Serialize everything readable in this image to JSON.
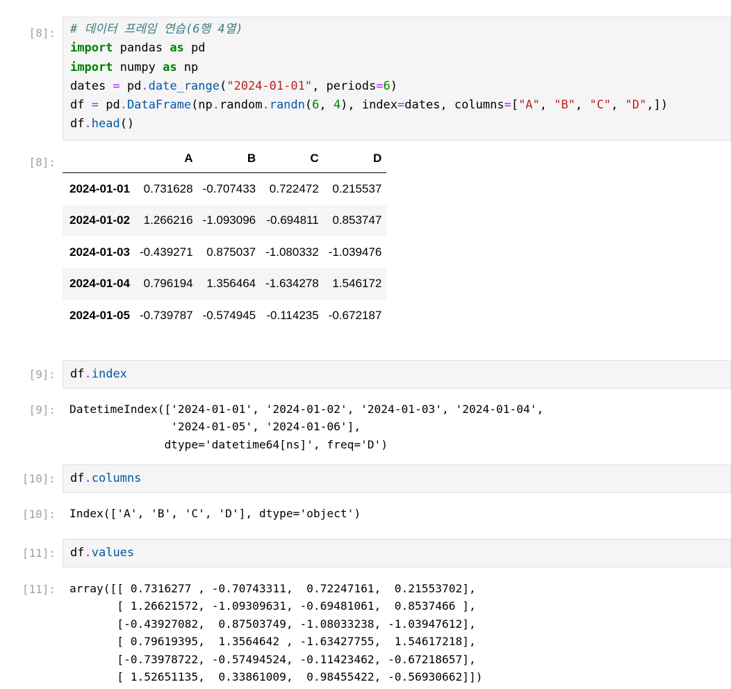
{
  "cells": [
    {
      "in_prompt": "[8]:",
      "out_prompt": "[8]:",
      "code_lines": [
        "# 데이터 프레임 연습(6행 4열)",
        "import pandas as pd",
        "import numpy as np",
        "dates = pd.date_range(\"2024-01-01\", periods=6)",
        "df = pd.DataFrame(np.random.randn(6, 4), index=dates, columns=[\"A\", \"B\", \"C\", \"D\",])",
        "df.head()"
      ],
      "table": {
        "columns": [
          "",
          "A",
          "B",
          "C",
          "D"
        ],
        "rows": [
          {
            "index": "2024-01-01",
            "values": [
              "0.731628",
              "-0.707433",
              "0.722472",
              "0.215537"
            ]
          },
          {
            "index": "2024-01-02",
            "values": [
              "1.266216",
              "-1.093096",
              "-0.694811",
              "0.853747"
            ]
          },
          {
            "index": "2024-01-03",
            "values": [
              "-0.439271",
              "0.875037",
              "-1.080332",
              "-1.039476"
            ]
          },
          {
            "index": "2024-01-04",
            "values": [
              "0.796194",
              "1.356464",
              "-1.634278",
              "1.546172"
            ]
          },
          {
            "index": "2024-01-05",
            "values": [
              "-0.739787",
              "-0.574945",
              "-0.114235",
              "-0.672187"
            ]
          }
        ]
      }
    },
    {
      "in_prompt": "[9]:",
      "out_prompt": "[9]:",
      "code": "df.index",
      "output_lines": [
        "DatetimeIndex(['2024-01-01', '2024-01-02', '2024-01-03', '2024-01-04',",
        "               '2024-01-05', '2024-01-06'],",
        "              dtype='datetime64[ns]', freq='D')"
      ]
    },
    {
      "in_prompt": "[10]:",
      "out_prompt": "[10]:",
      "code": "df.columns",
      "output_lines": [
        "Index(['A', 'B', 'C', 'D'], dtype='object')"
      ]
    },
    {
      "in_prompt": "[11]:",
      "out_prompt": "[11]:",
      "code": "df.values",
      "output_lines": [
        "array([[ 0.7316277 , -0.70743311,  0.72247161,  0.21553702],",
        "       [ 1.26621572, -1.09309631, -0.69481061,  0.8537466 ],",
        "       [-0.43927082,  0.87503749, -1.08033238, -1.03947612],",
        "       [ 0.79619395,  1.3564642 , -1.63427755,  1.54617218],",
        "       [-0.73978722, -0.57494524, -0.11423462, -0.67218657],",
        "       [ 1.52651135,  0.33861009,  0.98455422, -0.56930662]])"
      ]
    }
  ],
  "syntax_colors": {
    "comment": "#3d7b7b",
    "keyword": "#008000",
    "operator": "#aa22ff",
    "string": "#ba2121",
    "number": "#008000",
    "attribute": "#0055aa",
    "prompt": "#a0a0a0",
    "input_background": "#f5f5f5"
  }
}
